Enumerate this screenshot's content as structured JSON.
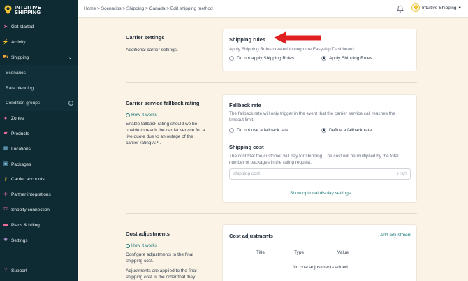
{
  "app": {
    "logo_line1": "INTUITIVE",
    "logo_line2": "SHIPPING"
  },
  "sidebar": {
    "items": [
      {
        "label": "Get started",
        "icon": "rocket-icon"
      },
      {
        "label": "Activity",
        "icon": "activity-icon"
      },
      {
        "label": "Shipping",
        "icon": "truck-icon",
        "expanded": true
      },
      {
        "label": "Scenarios"
      },
      {
        "label": "Rate blending"
      },
      {
        "label": "Condition groups"
      },
      {
        "label": "Zones",
        "icon": "globe-icon"
      },
      {
        "label": "Products",
        "icon": "box-icon"
      },
      {
        "label": "Locations",
        "icon": "building-icon"
      },
      {
        "label": "Packages",
        "icon": "package-icon"
      },
      {
        "label": "Carrier accounts",
        "icon": "key-icon"
      },
      {
        "label": "Partner integrations",
        "icon": "puzzle-icon"
      },
      {
        "label": "Shopify connection",
        "icon": "shopify-icon"
      },
      {
        "label": "Plans & billing",
        "icon": "card-icon"
      },
      {
        "label": "Settings",
        "icon": "gear-icon"
      }
    ],
    "support": "Support"
  },
  "topbar": {
    "breadcrumb": "Home > Scenarios > Shipping > Canada > Edit shipping method",
    "user": "Intuitive Shipping",
    "user_caret": "▾"
  },
  "carrier_settings": {
    "title": "Carrier settings",
    "desc": "Additional carrier settings.",
    "card": {
      "title": "Shipping rules",
      "text": "Apply Shipping Rules created through the Easyship Dashboard.",
      "options": [
        "Do not apply Shipping Rules",
        "Apply Shipping Rules"
      ],
      "selected": 1
    }
  },
  "fallback": {
    "title": "Carrier service fallback rating",
    "how": "How it works",
    "desc": "Enable fallback rating should we be unable to reach the carrier service for a live quote due to an outage of the carrier rating API.",
    "card": {
      "title": "Fallback rate",
      "text": "The fallback rate will only trigger in the event that the carrier service call reaches the timeout limit.",
      "options": [
        "Do not use a fallback rate",
        "Define a fallback rate"
      ],
      "selected": 1,
      "cost_title": "Shipping cost",
      "cost_text": "The cost that the customer will pay for shipping. The cost will be multiplied by the total number of packages in the rating request.",
      "input_placeholder": "shipping cost",
      "unit": "USD",
      "optional_link": "Show optional display settings"
    }
  },
  "cost_adjustments": {
    "title": "Cost adjustments",
    "how": "How it works",
    "desc1": "Configure adjustments to the final shipping cost.",
    "desc2": "Adjustments are applied to the final shipping cost in the order that they",
    "card": {
      "title": "Cost adjustments",
      "add_link": "Add adjustment",
      "columns": [
        "Title",
        "Type",
        "Value"
      ],
      "empty": "No cost adjustments added"
    }
  },
  "colors": {
    "sidebar": "#0e2a33",
    "accent": "#1f7a7a",
    "background": "#fbf4e6",
    "arrow": "#e02020"
  }
}
